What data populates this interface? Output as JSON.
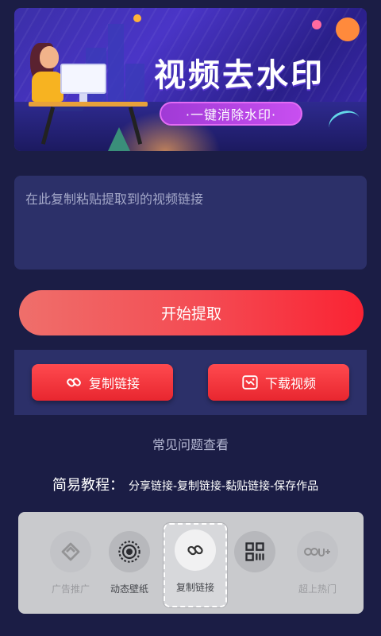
{
  "banner": {
    "title": "视频去水印",
    "subtitle": "·一键消除水印·"
  },
  "input": {
    "placeholder": "在此复制粘贴提取到的视频链接",
    "value": ""
  },
  "start_button": {
    "label": "开始提取"
  },
  "actions": {
    "copy": {
      "label": "复制链接",
      "icon": "link-icon"
    },
    "download": {
      "label": "下载视频",
      "icon": "video-download-icon"
    }
  },
  "faq": {
    "label": "常见问题查看"
  },
  "tutorial": {
    "heading": "简易教程：",
    "steps": "分享链接-复制链接-黏贴链接-保存作品"
  },
  "bottom_bar": {
    "items": [
      {
        "label": "广告推广",
        "icon": "ad-icon",
        "state": "faded"
      },
      {
        "label": "动态壁纸",
        "icon": "disc-icon",
        "state": "normal"
      },
      {
        "label": "复制链接",
        "icon": "link-icon",
        "state": "selected"
      },
      {
        "label": "",
        "icon": "qrcode-icon",
        "state": "normal"
      },
      {
        "label": "超上热门",
        "icon": "trending-icon",
        "state": "faded"
      }
    ]
  },
  "colors": {
    "background": "#1b1d45",
    "panel": "#2c3069",
    "accent_red": "#f44a52",
    "banner_purple": "#4a35c7"
  }
}
